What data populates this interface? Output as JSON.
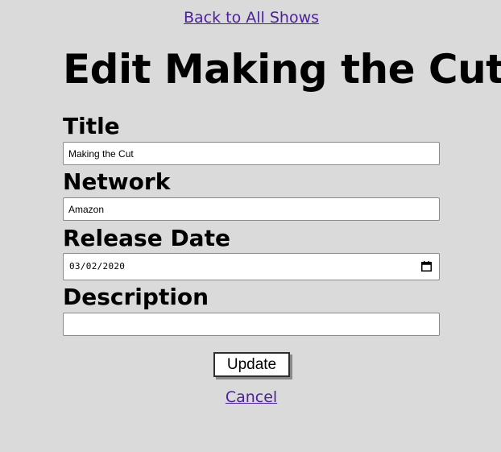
{
  "nav": {
    "back_link": "Back to All Shows"
  },
  "page": {
    "title": "Edit Making the Cut"
  },
  "form": {
    "title_label": "Title",
    "title_value": "Making the Cut",
    "network_label": "Network",
    "network_value": "Amazon",
    "release_date_label": "Release Date",
    "release_date_value": "03/02/2020",
    "description_label": "Description",
    "description_value": "",
    "update_label": "Update",
    "cancel_label": "Cancel"
  },
  "icons": {
    "date_picker": "calendar-icon"
  },
  "colors": {
    "background": "#dadada",
    "link": "#4b1fa0"
  }
}
